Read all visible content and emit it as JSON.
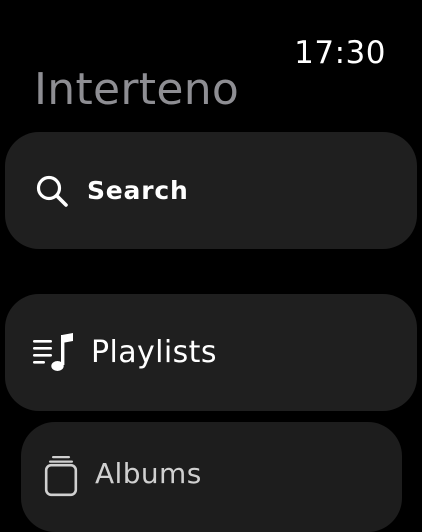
{
  "status_bar": {
    "time": "17:30"
  },
  "header": {
    "title": "Interteno"
  },
  "menu": {
    "search": {
      "label": "Search",
      "icon": "search-icon"
    },
    "playlists": {
      "label": "Playlists",
      "icon": "playlist-icon"
    },
    "albums": {
      "label": "Albums",
      "icon": "albums-icon"
    }
  },
  "colors": {
    "background": "#000000",
    "card": "#1f1f1f",
    "title": "#8e8e93",
    "text": "#ffffff"
  }
}
